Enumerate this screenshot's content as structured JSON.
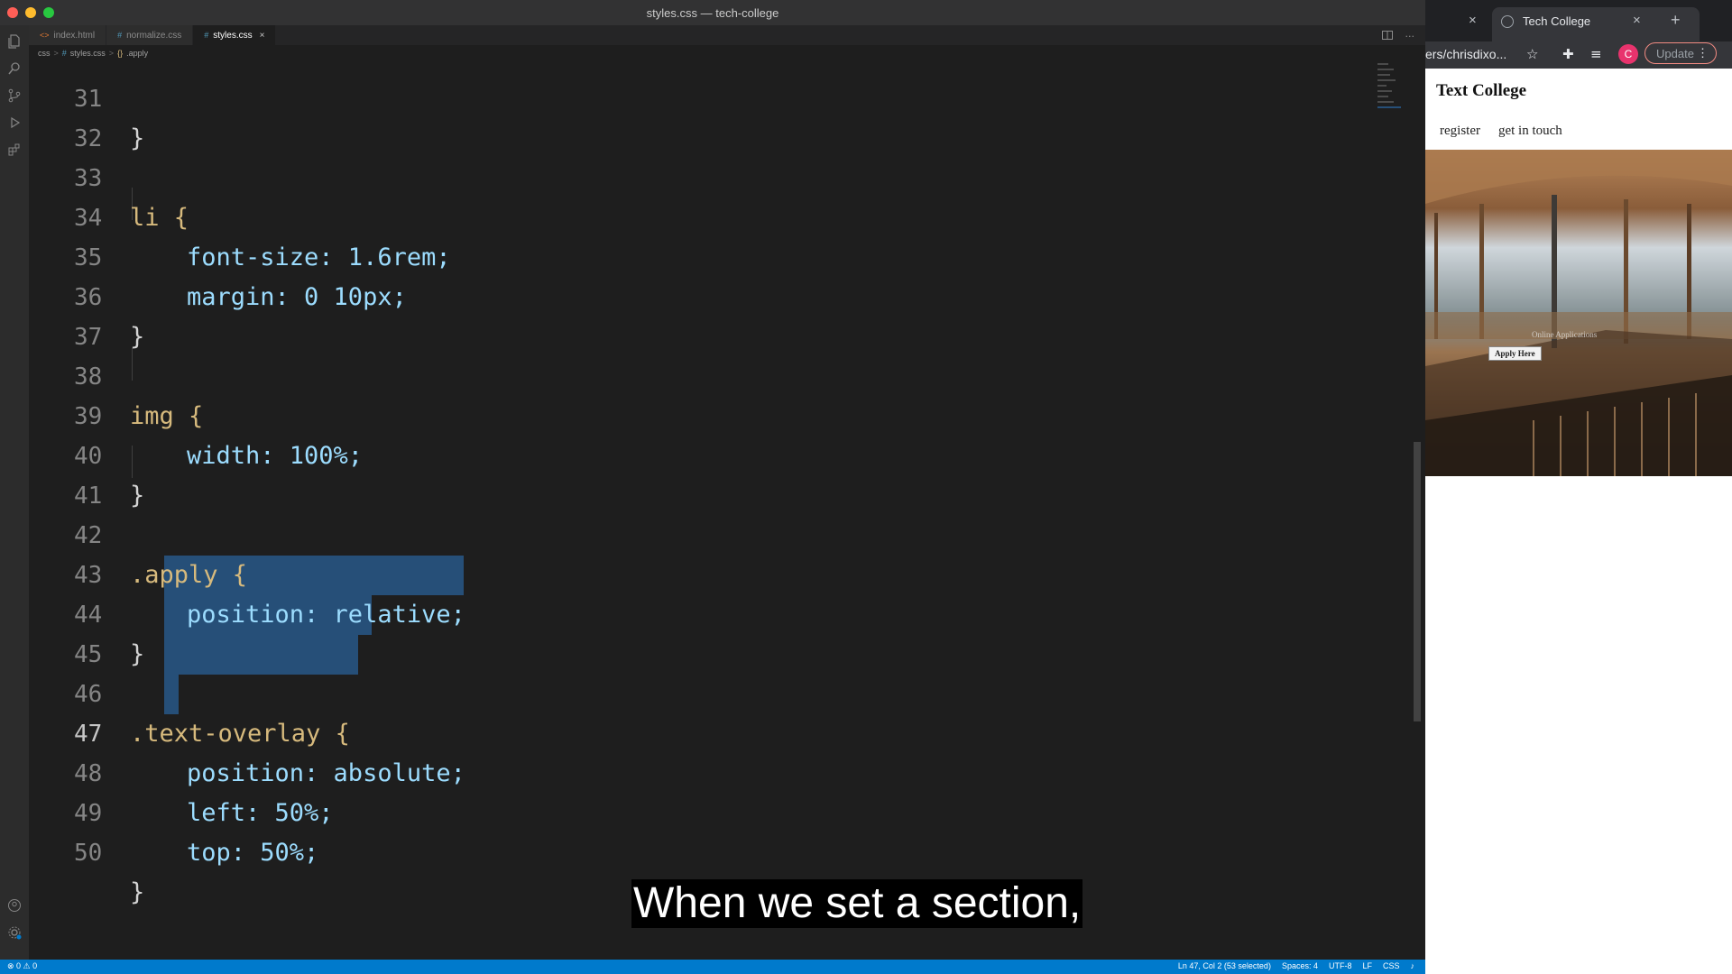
{
  "vscode": {
    "window_title": "styles.css — tech-college",
    "tabs": [
      {
        "icon": "<>",
        "label": "index.html",
        "active": false
      },
      {
        "icon": "#",
        "label": "normalize.css",
        "active": false
      },
      {
        "icon": "#",
        "label": "styles.css",
        "active": true,
        "close": "×"
      }
    ],
    "breadcrumb": {
      "folder": "css",
      "file": "styles.css",
      "symbol": ".apply",
      "separator": ">"
    },
    "code_lines": [
      {
        "n": "31",
        "text": "}"
      },
      {
        "n": "32",
        "text": ""
      },
      {
        "n": "33",
        "text": "li {"
      },
      {
        "n": "34",
        "text": "font-size: 1.6rem;"
      },
      {
        "n": "35",
        "text": "margin: 0 10px;"
      },
      {
        "n": "36",
        "text": "}"
      },
      {
        "n": "37",
        "text": ""
      },
      {
        "n": "38",
        "text": "img {"
      },
      {
        "n": "39",
        "text": "width: 100%;"
      },
      {
        "n": "40",
        "text": "}"
      },
      {
        "n": "41",
        "text": ""
      },
      {
        "n": "42",
        "text": ".apply {"
      },
      {
        "n": "43",
        "text": "position: relative;"
      },
      {
        "n": "44",
        "text": "}"
      },
      {
        "n": "45",
        "text": ""
      },
      {
        "n": "46",
        "text": ".text-overlay {"
      },
      {
        "n": "47",
        "text": "position: absolute;"
      },
      {
        "n": "48",
        "text": "left: 50%;"
      },
      {
        "n": "49",
        "text": "top: 50%;"
      },
      {
        "n": "50",
        "text": "}"
      }
    ],
    "current_line": "47",
    "status": {
      "left": "⊗ 0 ⚠ 0",
      "position": "Ln 47, Col 2 (53 selected)",
      "spaces": "Spaces: 4",
      "encoding": "UTF-8",
      "eol": "LF",
      "language": "CSS"
    }
  },
  "browser": {
    "tab_title": "Tech College",
    "tab_close": "×",
    "new_tab": "+",
    "url": "ers/chrisdixo...",
    "update_label": "Update",
    "avatar_letter": "C",
    "page": {
      "site_title": "Text College",
      "nav": [
        "register",
        "get in touch"
      ],
      "apply_button": "Apply Here",
      "hero_caption": "Online Applications"
    }
  },
  "subtitle": "When we set a section,",
  "colors": {
    "editor_bg": "#1e1e1e",
    "selection": "#264f78",
    "statusbar": "#007acc",
    "selector": "#d7ba7d",
    "property": "#9cdcfe",
    "number": "#b5cea8",
    "keyword_value": "#ce9178"
  }
}
